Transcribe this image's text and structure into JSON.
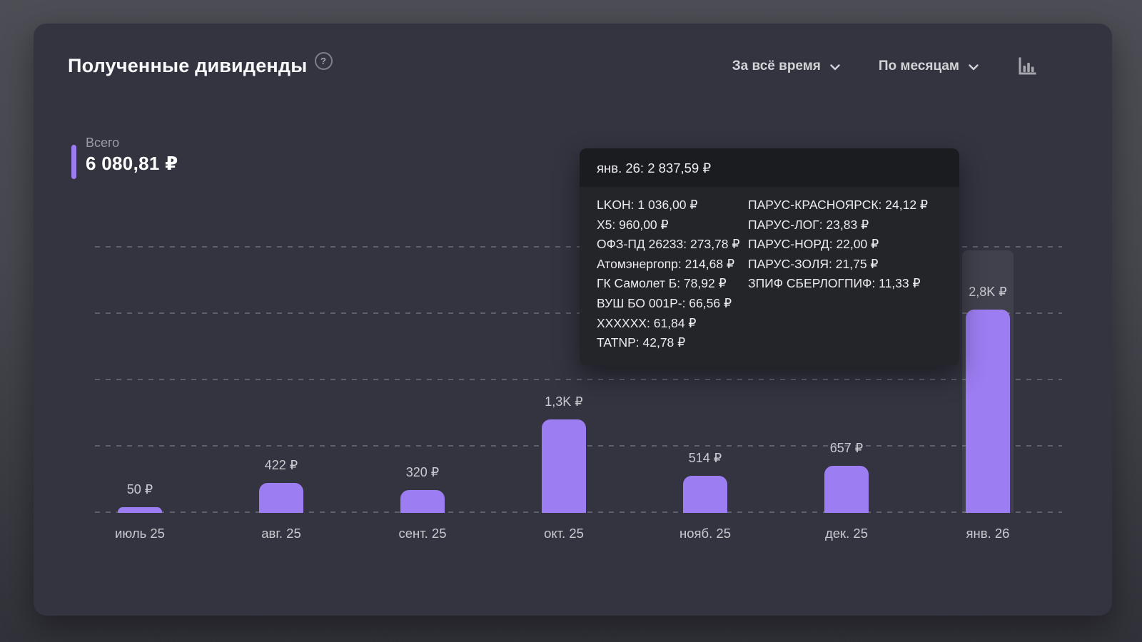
{
  "panel": {
    "title": "Полученные дивиденды",
    "help_glyph": "?",
    "period_filter": "За всё время",
    "grouping_filter": "По месяцам",
    "total_label": "Всего",
    "total_value": "6 080,81 ₽"
  },
  "tooltip": {
    "title": "янв. 26: 2 837,59 ₽",
    "columns": [
      [
        "LKOH: 1 036,00 ₽",
        "X5: 960,00 ₽",
        "ОФЗ-ПД 26233: 273,78 ₽",
        "Атомэнергопр: 214,68 ₽",
        "ГК Самолет Б: 78,92 ₽",
        "ВУШ БО 001Р-: 66,56 ₽",
        "XXXXXX: 61,84 ₽",
        "TATNP: 42,78 ₽"
      ],
      [
        "ПАРУС-КРАСНОЯРСК: 24,12 ₽",
        "ПАРУС-ЛОГ: 23,83 ₽",
        "ПАРУС-НОРД: 22,00 ₽",
        "ПАРУС-ЗОЛЯ: 21,75 ₽",
        "ЗПИФ СБЕРЛОГПИФ: 11,33 ₽"
      ]
    ]
  },
  "chart_data": {
    "type": "bar",
    "title": "Полученные дивиденды",
    "categories": [
      "июль 25",
      "авг. 25",
      "сент. 25",
      "окт. 25",
      "нояб. 25",
      "дек. 25",
      "янв. 26"
    ],
    "values": [
      50,
      422,
      320,
      1300,
      514,
      657,
      2837.59
    ],
    "value_labels": [
      "50 ₽",
      "422 ₽",
      "320 ₽",
      "1,3K ₽",
      "514 ₽",
      "657 ₽",
      "2,8K ₽"
    ],
    "highlighted_index": 6,
    "highlighted_total": "2 837,59 ₽",
    "ylim": [
      0,
      3700
    ],
    "grid": "horizontal-dashed",
    "legend": "none",
    "bar_color": "#9c7df2"
  },
  "colors": {
    "accent": "#9d7df2",
    "panel_bg": "#333440",
    "tooltip_bg": "#242529",
    "tooltip_header_bg": "#1b1c20",
    "text_primary": "#ffffff",
    "text_secondary": "#c9cacf"
  }
}
